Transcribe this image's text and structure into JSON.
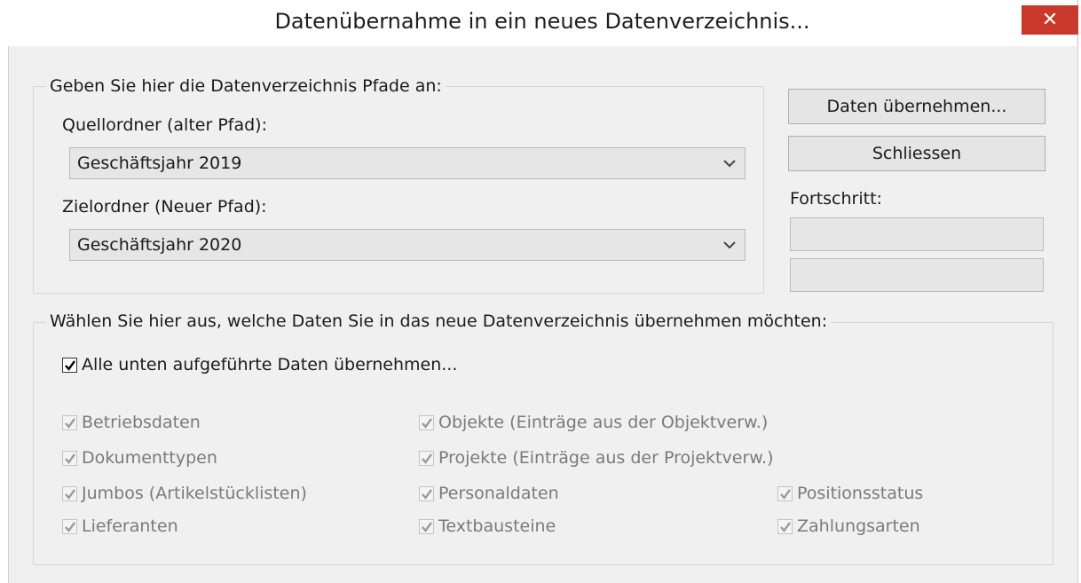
{
  "window": {
    "title": "Datenübernahme in ein neues Datenverzeichnis...",
    "close_glyph": "✕"
  },
  "paths_group": {
    "legend": "Geben Sie hier die Datenverzeichnis Pfade an:",
    "source_label": "Quellordner (alter Pfad):",
    "source_value": "Geschäftsjahr 2019",
    "target_label": "Zielordner (Neuer Pfad):",
    "target_value": "Geschäftsjahr 2020"
  },
  "buttons": {
    "transfer": "Daten übernehmen...",
    "close": "Schliessen"
  },
  "progress": {
    "label": "Fortschritt:",
    "bar1_fraction": 0,
    "bar2_fraction": 0
  },
  "data_group": {
    "legend": "Wählen Sie hier aus, welche Daten Sie in das neue Datenverzeichnis übernehmen möchten:",
    "select_all": {
      "label": "Alle unten aufgeführte Daten übernehmen...",
      "checked": true
    },
    "items": [
      {
        "label": "Betriebsdaten",
        "checked": true,
        "enabled": false
      },
      {
        "label": "Dokumenttypen",
        "checked": true,
        "enabled": false
      },
      {
        "label": "Jumbos (Artikelstücklisten)",
        "checked": true,
        "enabled": false
      },
      {
        "label": "Lieferanten",
        "checked": true,
        "enabled": false
      },
      {
        "label": "Objekte (Einträge aus der Objektverw.)",
        "checked": true,
        "enabled": false
      },
      {
        "label": "Projekte (Einträge aus der Projektverw.)",
        "checked": true,
        "enabled": false
      },
      {
        "label": "Personaldaten",
        "checked": true,
        "enabled": false
      },
      {
        "label": "Textbausteine",
        "checked": true,
        "enabled": false
      },
      {
        "label": "Positionsstatus",
        "checked": true,
        "enabled": false
      },
      {
        "label": "Zahlungsarten",
        "checked": true,
        "enabled": false
      }
    ]
  },
  "colors": {
    "close_button": "#c8392b",
    "dialog_bg": "#f0f0f0",
    "progress_fill": "#06b025"
  },
  "icons": {
    "combo_arrow": "chevron-down-icon",
    "check": "check-icon"
  }
}
